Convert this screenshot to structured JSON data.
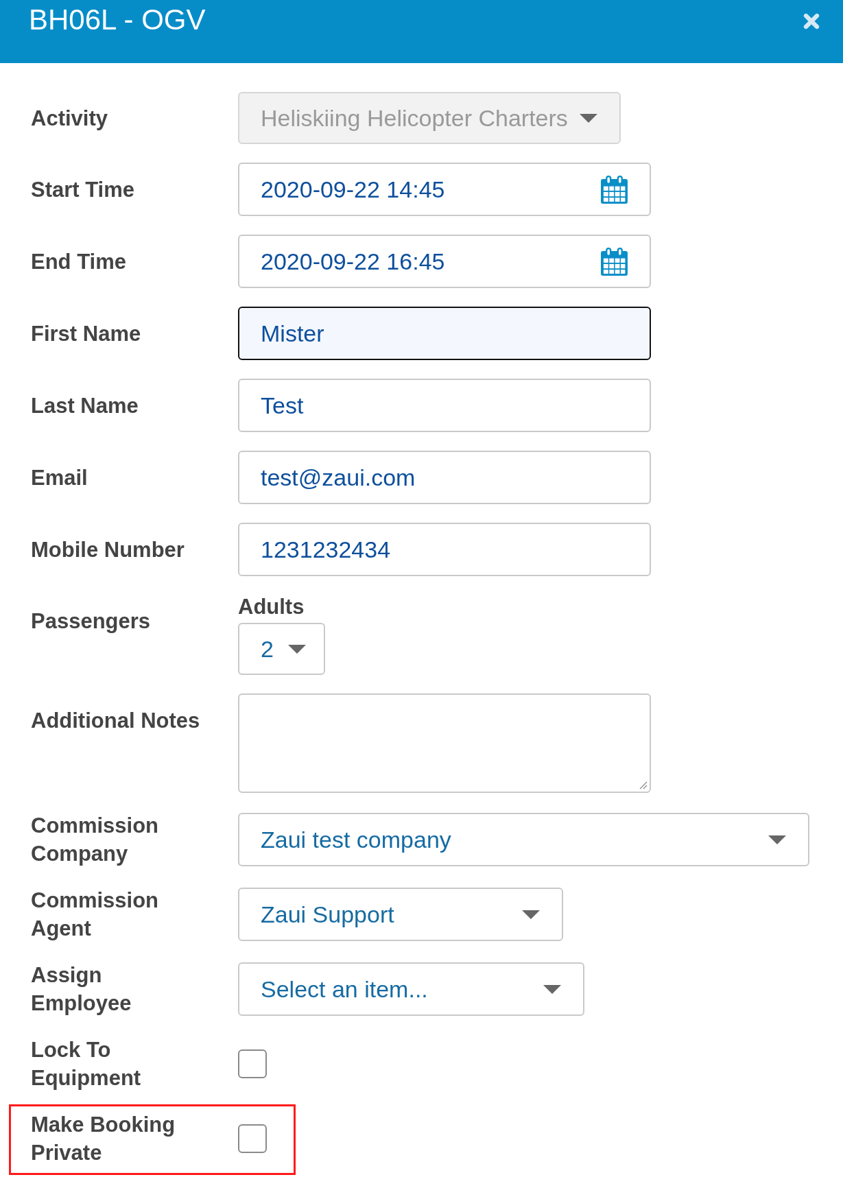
{
  "dialog": {
    "title": "BH06L - OGV"
  },
  "form": {
    "fields": [
      {
        "kind": "select",
        "label": "Activity",
        "value": "Heliskiing Helicopter Charters",
        "disabled": true,
        "focused": false,
        "highlighted": false
      },
      {
        "kind": "datetime",
        "label": "Start Time",
        "value": "2020-09-22 14:45",
        "disabled": false,
        "focused": false,
        "highlighted": false
      },
      {
        "kind": "datetime",
        "label": "End Time",
        "value": "2020-09-22 16:45",
        "disabled": false,
        "focused": false,
        "highlighted": false
      },
      {
        "kind": "input",
        "label": "First Name",
        "value": "Mister",
        "disabled": false,
        "focused": true,
        "highlighted": false
      },
      {
        "kind": "input",
        "label": "Last Name",
        "value": "Test",
        "disabled": false,
        "focused": false,
        "highlighted": false
      },
      {
        "kind": "input",
        "label": "Email",
        "value": "test@zaui.com",
        "disabled": false,
        "focused": false,
        "highlighted": false
      },
      {
        "kind": "input",
        "label": "Mobile Number",
        "value": "1231232434",
        "disabled": false,
        "focused": false,
        "highlighted": false
      },
      {
        "kind": "count",
        "label": "Passengers",
        "sublabel": "Adults",
        "value": "2",
        "disabled": false,
        "focused": false,
        "highlighted": false
      },
      {
        "kind": "textarea",
        "label": "Additional Notes",
        "disabled": false,
        "focused": false,
        "highlighted": false
      },
      {
        "kind": "select",
        "label": "Commission Company",
        "value": "Zaui test company",
        "disabled": false,
        "focused": false,
        "highlighted": false
      },
      {
        "kind": "select",
        "label": "Commission Agent",
        "value": "Zaui Support",
        "disabled": false,
        "focused": false,
        "highlighted": false
      },
      {
        "kind": "select",
        "label": "Assign Employee",
        "placeholder": "Select an item...",
        "disabled": false,
        "focused": false,
        "highlighted": false
      },
      {
        "kind": "checkbox",
        "label": "Lock To Equipment",
        "checked": false,
        "disabled": false,
        "focused": false,
        "highlighted": false
      },
      {
        "kind": "checkbox",
        "label": "Make Booking Private",
        "checked": false,
        "disabled": false,
        "focused": false,
        "highlighted": true
      }
    ]
  }
}
